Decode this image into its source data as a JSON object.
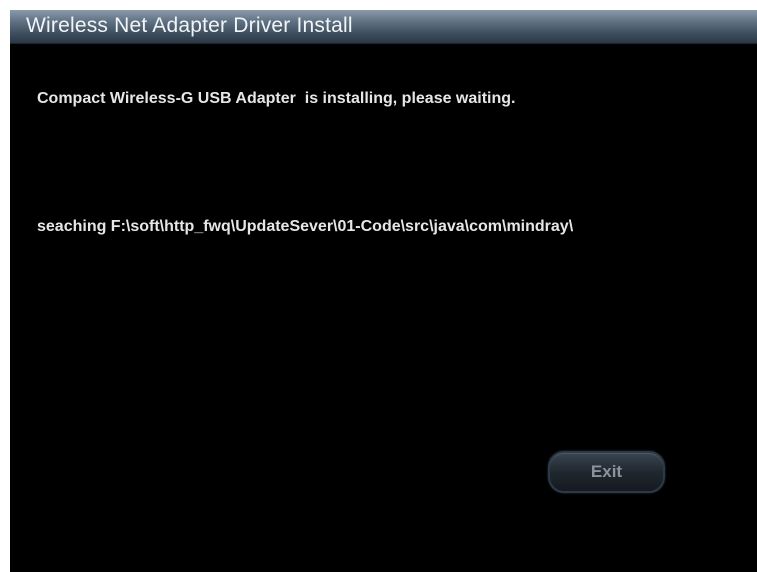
{
  "window": {
    "title": "Wireless Net Adapter Driver Install"
  },
  "content": {
    "status_message": "Compact Wireless-G USB Adapter  is installing, please waiting.",
    "search_message": "seaching F:\\soft\\http_fwq\\UpdateSever\\01-Code\\src\\java\\com\\mindray\\"
  },
  "buttons": {
    "exit_label": "Exit"
  },
  "colors": {
    "background": "#000000",
    "text": "#e6e6e6",
    "titlebar": "#5f7183",
    "button_text": "#8c939a"
  }
}
